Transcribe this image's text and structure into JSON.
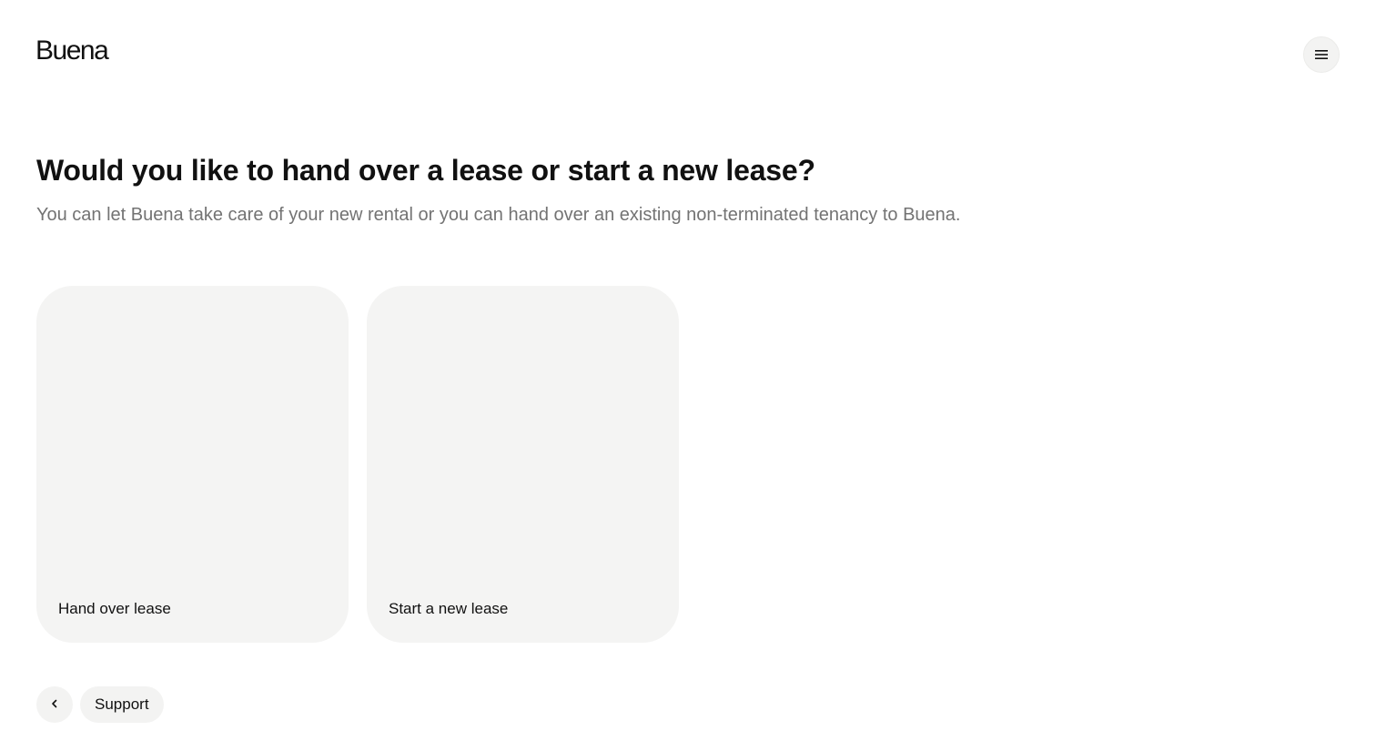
{
  "header": {
    "logo_text": "Buena",
    "menu_icon": "hamburger-menu-icon"
  },
  "main": {
    "title": "Would you like to hand over a lease or start a new lease?",
    "subtitle": "You can let Buena take care of your new rental or you can hand over an existing non-terminated tenancy to Buena.",
    "options": [
      {
        "label": "Hand over lease"
      },
      {
        "label": "Start a new lease"
      }
    ]
  },
  "footer": {
    "back_icon": "chevron-left-icon",
    "support_label": "Support"
  },
  "colors": {
    "background": "#ffffff",
    "card_background": "#f4f4f3",
    "button_background": "#f3f3f2",
    "text_primary": "#111111",
    "text_secondary": "#737373"
  }
}
